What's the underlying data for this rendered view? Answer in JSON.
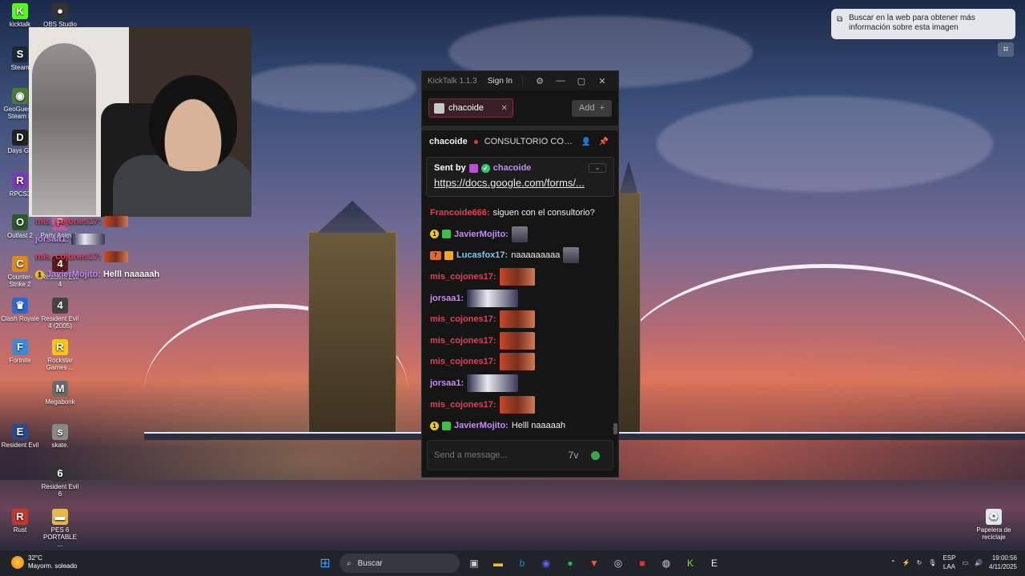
{
  "desktop": {
    "icons": [
      {
        "label": "kicktalk",
        "glyph": "K",
        "color": "#53fc18"
      },
      {
        "label": "OBS Studio",
        "glyph": "●",
        "color": "#333333"
      },
      {
        "label": "Steam",
        "glyph": "S",
        "color": "#1b2838"
      },
      {
        "label": "GeoGuessr Steam E",
        "glyph": "◉",
        "color": "#4a7a3a"
      },
      {
        "label": "Days Go",
        "glyph": "D",
        "color": "#222222"
      },
      {
        "label": "RPCS3",
        "glyph": "R",
        "color": "#7a3ab5"
      },
      {
        "label": "Outlast 2",
        "glyph": "O",
        "color": "#2a5a2a"
      },
      {
        "label": "Party Animals",
        "glyph": "P",
        "color": "#c05a9a"
      },
      {
        "label": "Counter-Strike 2",
        "glyph": "C",
        "color": "#d98a1a"
      },
      {
        "label": "Resident Evil 4",
        "glyph": "4",
        "color": "#5a1a1a"
      },
      {
        "label": "Clash Royale",
        "glyph": "♛",
        "color": "#2a6ad0"
      },
      {
        "label": "Resident Evil 4 (2005)",
        "glyph": "4",
        "color": "#444444"
      },
      {
        "label": "Fortnite",
        "glyph": "F",
        "color": "#3a8ad9"
      },
      {
        "label": "Rockstar Games ...",
        "glyph": "R",
        "color": "#f5c518"
      },
      {
        "label": "Megabonk",
        "glyph": "M",
        "color": "#6a6a6a"
      },
      {
        "label": "Resident Evil",
        "glyph": "E",
        "color": "#2a4a8a"
      },
      {
        "label": "skate.",
        "glyph": "s",
        "color": "#888888"
      },
      {
        "label": "Resident Evil 6",
        "glyph": "6",
        "color": "#333333"
      },
      {
        "label": "Rust",
        "glyph": "R",
        "color": "#c0392b"
      },
      {
        "label": "PES 6 PORTABLE ...",
        "glyph": "▬",
        "color": "#e5b94a"
      },
      {
        "label": "Papelera de reciclaje",
        "glyph": "♻",
        "color": "#dfe6ee"
      }
    ]
  },
  "overlay_chat": [
    {
      "user": "mis_cojones17:",
      "color": "#e0405a",
      "text": "",
      "emote": "red"
    },
    {
      "user": "jorsaa1:",
      "color": "#c48df5",
      "text": "",
      "emote": "wide"
    },
    {
      "user": "mis_cojones17:",
      "color": "#e0405a",
      "text": "",
      "emote": "red"
    },
    {
      "user": "JavierMojito:",
      "color": "#c48df5",
      "text": "Helll naaaaah",
      "emote": ""
    }
  ],
  "lens": {
    "text": "Buscar en la web para obtener más información sobre esta imagen"
  },
  "kicktalk": {
    "app_title": "KickTalk 1.1.3",
    "sign_in": "Sign In",
    "tab_label": "chacoide",
    "add_label": "Add",
    "stream_name": "chacoide",
    "stream_title": "CONSULTORIO CON...",
    "pinned": {
      "sent_by": "Sent by",
      "user": "chacoide",
      "link": "https://docs.google.com/forms/..."
    },
    "messages": [
      {
        "user": "Francoide666:",
        "color": "#e0405a",
        "text": "siguen con el consultorio?",
        "badges": [],
        "emote": ""
      },
      {
        "user": "JavierMojito:",
        "color": "#c48df5",
        "text": "",
        "badges": [
          "one",
          "sub"
        ],
        "emote": "face"
      },
      {
        "user": "Lucasfox17:",
        "color": "#7ec8f0",
        "text": "naaaaaaaaa",
        "badges": [
          "num",
          "crown"
        ],
        "emote": "face"
      },
      {
        "user": "mis_cojones17:",
        "color": "#e0405a",
        "text": "",
        "badges": [],
        "emote": "red"
      },
      {
        "user": "jorsaa1:",
        "color": "#c48df5",
        "text": "",
        "badges": [],
        "emote": "wide"
      },
      {
        "user": "mis_cojones17:",
        "color": "#e0405a",
        "text": "",
        "badges": [],
        "emote": "red"
      },
      {
        "user": "mis_cojones17:",
        "color": "#e0405a",
        "text": "",
        "badges": [],
        "emote": "red"
      },
      {
        "user": "mis_cojones17:",
        "color": "#e0405a",
        "text": "",
        "badges": [],
        "emote": "red"
      },
      {
        "user": "jorsaa1:",
        "color": "#c48df5",
        "text": "",
        "badges": [],
        "emote": "wide"
      },
      {
        "user": "mis_cojones17:",
        "color": "#e0405a",
        "text": "",
        "badges": [],
        "emote": "red"
      },
      {
        "user": "JavierMojito:",
        "color": "#c48df5",
        "text": "Helll naaaaah",
        "badges": [
          "one",
          "sub"
        ],
        "emote": ""
      }
    ],
    "input_placeholder": "Send a message..."
  },
  "taskbar": {
    "temperature": "32°C",
    "weather": "Mayorm. soleado",
    "search": "Buscar",
    "lang_top": "ESP",
    "lang_bottom": "LAA",
    "time": "19:00:56",
    "date": "4/11/2025"
  }
}
